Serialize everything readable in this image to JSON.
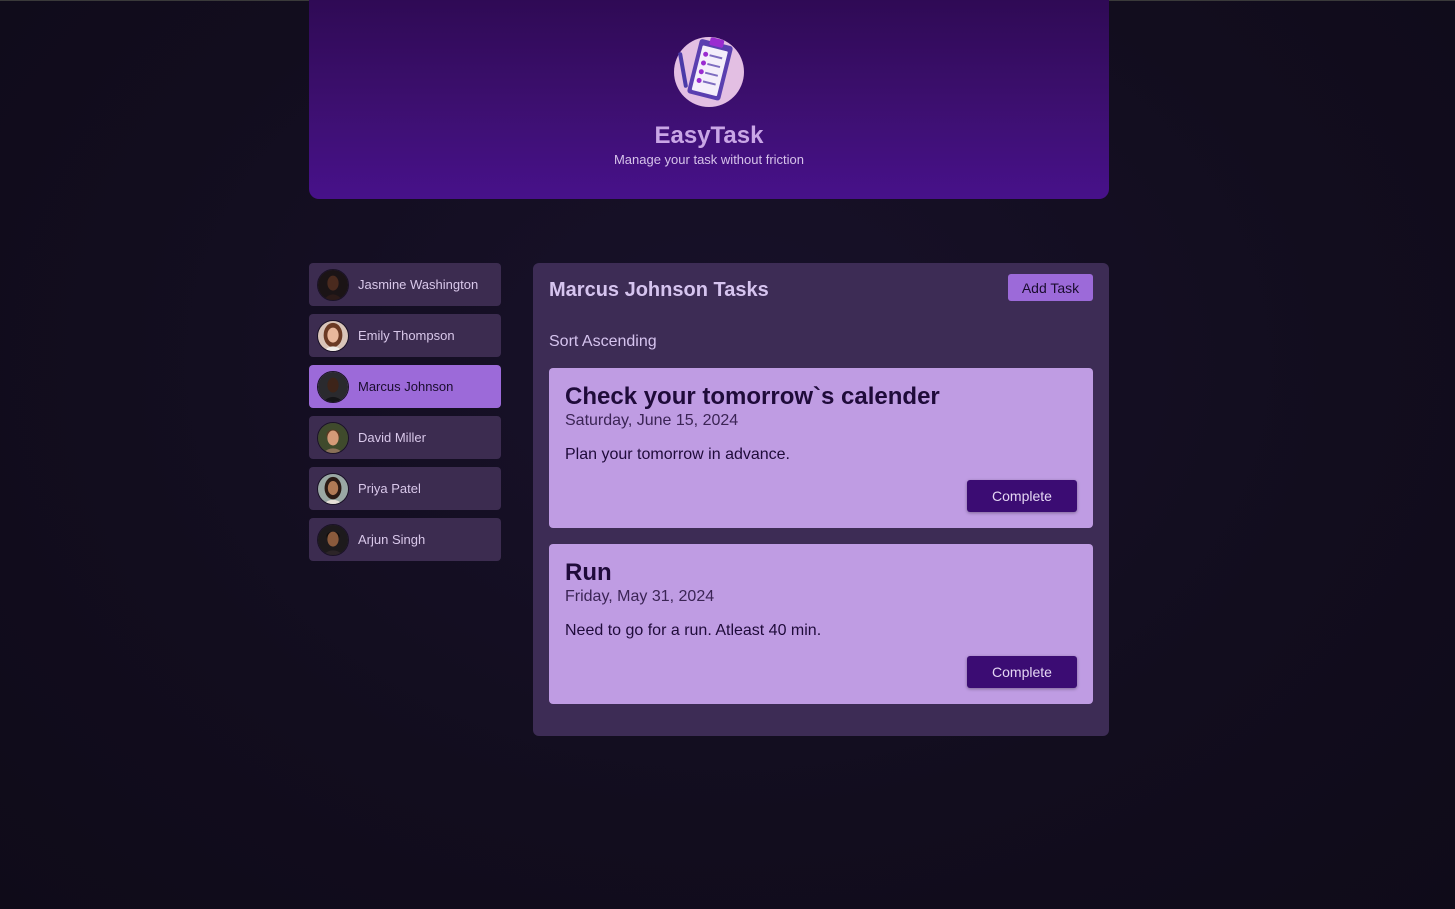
{
  "app": {
    "title": "EasyTask",
    "subtitle": "Manage your task without friction",
    "logo_icon": "clipboard-checklist-icon"
  },
  "users": [
    {
      "name": "Jasmine Washington",
      "selected": false
    },
    {
      "name": "Emily Thompson",
      "selected": false
    },
    {
      "name": "Marcus Johnson",
      "selected": true
    },
    {
      "name": "David Miller",
      "selected": false
    },
    {
      "name": "Priya Patel",
      "selected": false
    },
    {
      "name": "Arjun Singh",
      "selected": false
    }
  ],
  "tasks_panel": {
    "title": "Marcus Johnson Tasks",
    "add_task_label": "Add Task",
    "sort_label": "Sort Ascending",
    "tasks": [
      {
        "title": "Check your tomorrow`s calender",
        "date": "Saturday, June 15, 2024",
        "description": "Plan your tomorrow in advance.",
        "complete_label": "Complete"
      },
      {
        "title": "Run",
        "date": "Friday, May 31, 2024",
        "description": "Need to go for a run. Atleast 40 min.",
        "complete_label": "Complete"
      }
    ]
  },
  "colors": {
    "header_accent": "#3c0f6e",
    "selected_user": "#9c6ad9",
    "task_card": "#bf9ce3",
    "complete_button": "#3b0c73"
  }
}
